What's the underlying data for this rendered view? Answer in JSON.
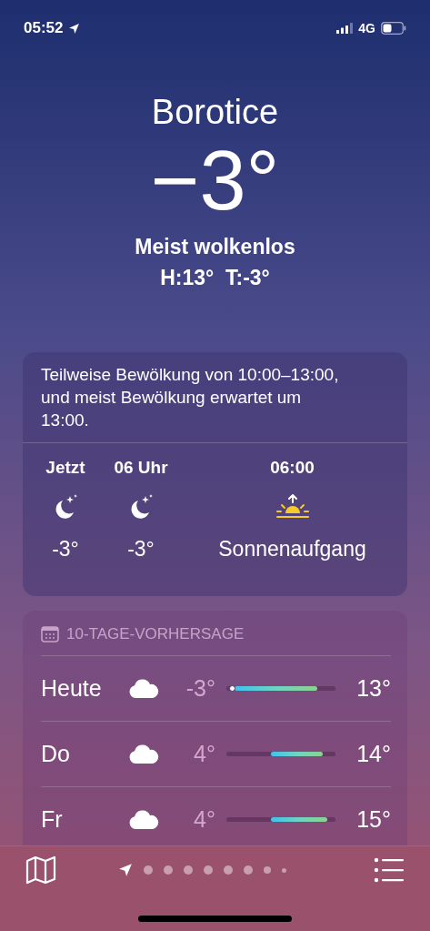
{
  "status_bar": {
    "time": "05:52",
    "network": "4G"
  },
  "location": {
    "city": "Borotice",
    "temperature": "−3°",
    "condition": "Meist wolkenlos",
    "high_low": "H:13°  T:-3°"
  },
  "hourly_card": {
    "summary": "Teilweise Bewölkung von 10:00–13:00, und meist Bewölkung erwartet um 13:00.",
    "hours": [
      {
        "time": "Jetzt",
        "kind": "moon",
        "value": "-3°"
      },
      {
        "time": "06 Uhr",
        "kind": "moon",
        "value": "-3°"
      },
      {
        "time": "06:00",
        "kind": "sunrise",
        "value": "Sonnenaufgang"
      }
    ]
  },
  "forecast_card": {
    "title": "10-TAGE-VORHERSAGE",
    "days": [
      {
        "day": "Heute",
        "kind": "cloud",
        "low": "-3°",
        "high": "13°",
        "current_marker": true
      },
      {
        "day": "Do",
        "kind": "cloud",
        "low": "4°",
        "high": "14°",
        "current_marker": false
      },
      {
        "day": "Fr",
        "kind": "cloud",
        "low": "4°",
        "high": "15°",
        "current_marker": false
      }
    ]
  },
  "pages": [
    {
      "kind": "location",
      "selected": true
    },
    {
      "kind": "dot",
      "selected": false
    },
    {
      "kind": "dot",
      "selected": false
    },
    {
      "kind": "dot",
      "selected": false
    },
    {
      "kind": "dot",
      "selected": false
    },
    {
      "kind": "dot",
      "selected": false
    },
    {
      "kind": "dot",
      "selected": false
    },
    {
      "kind": "dot",
      "selected": false
    },
    {
      "kind": "dot",
      "selected": false
    }
  ]
}
